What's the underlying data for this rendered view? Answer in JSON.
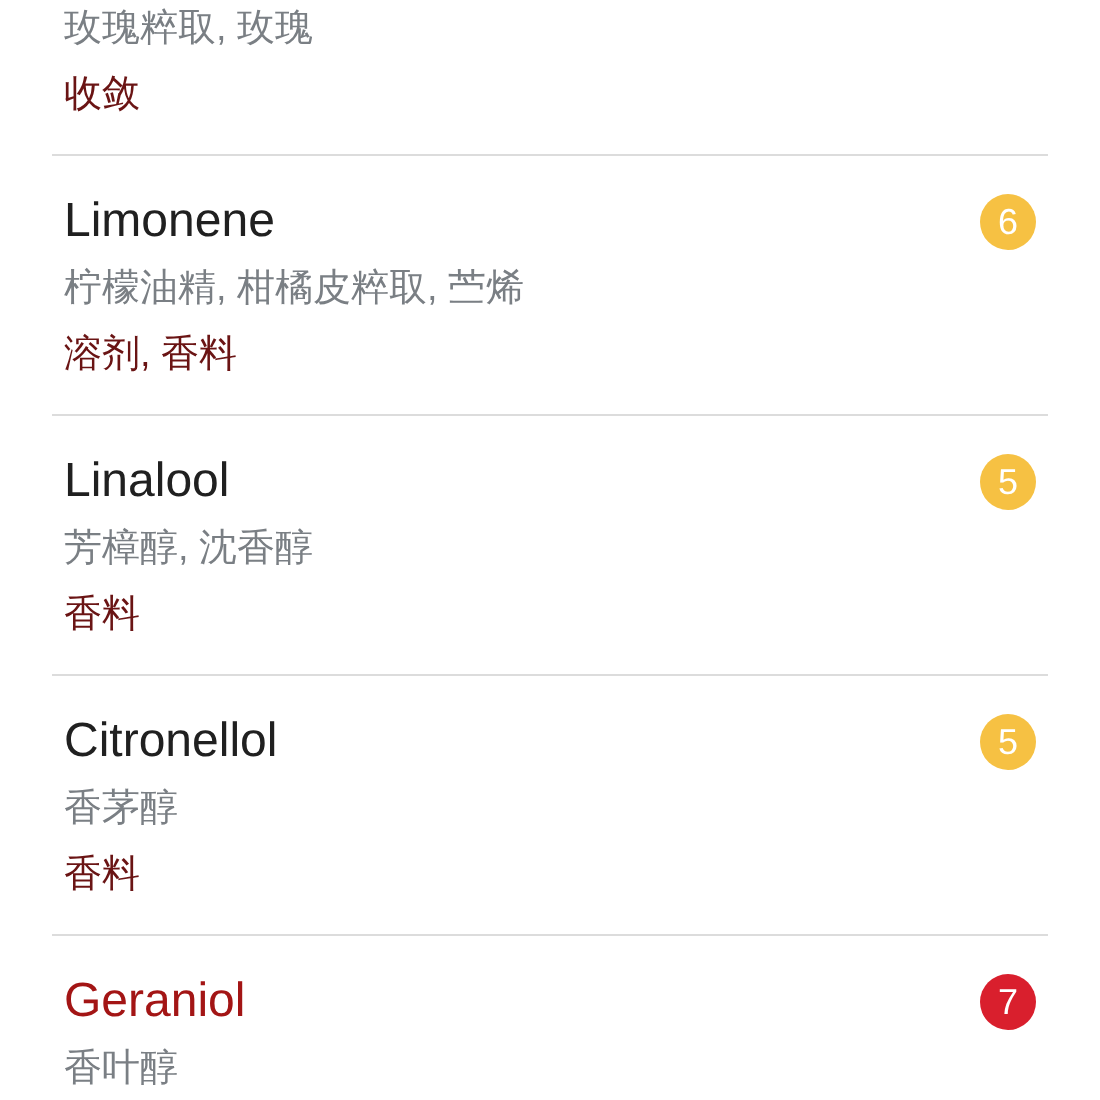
{
  "ingredients": [
    {
      "synonyms": "玫瑰粹取, 玫瑰",
      "functions": "收敛"
    },
    {
      "name": "Limonene",
      "flagged": false,
      "rating": "6",
      "color": "#f6c143",
      "synonyms": "柠檬油精, 柑橘皮粹取, 苎烯",
      "functions": "溶剂, 香料"
    },
    {
      "name": "Linalool",
      "flagged": false,
      "rating": "5",
      "color": "#f6c143",
      "synonyms": "芳樟醇, 沈香醇",
      "functions": "香料"
    },
    {
      "name": "Citronellol",
      "flagged": false,
      "rating": "5",
      "color": "#f6c143",
      "synonyms": "香茅醇",
      "functions": "香料"
    },
    {
      "name": "Geraniol",
      "flagged": true,
      "rating": "7",
      "color": "#d91f2d",
      "synonyms": "香叶醇"
    }
  ]
}
